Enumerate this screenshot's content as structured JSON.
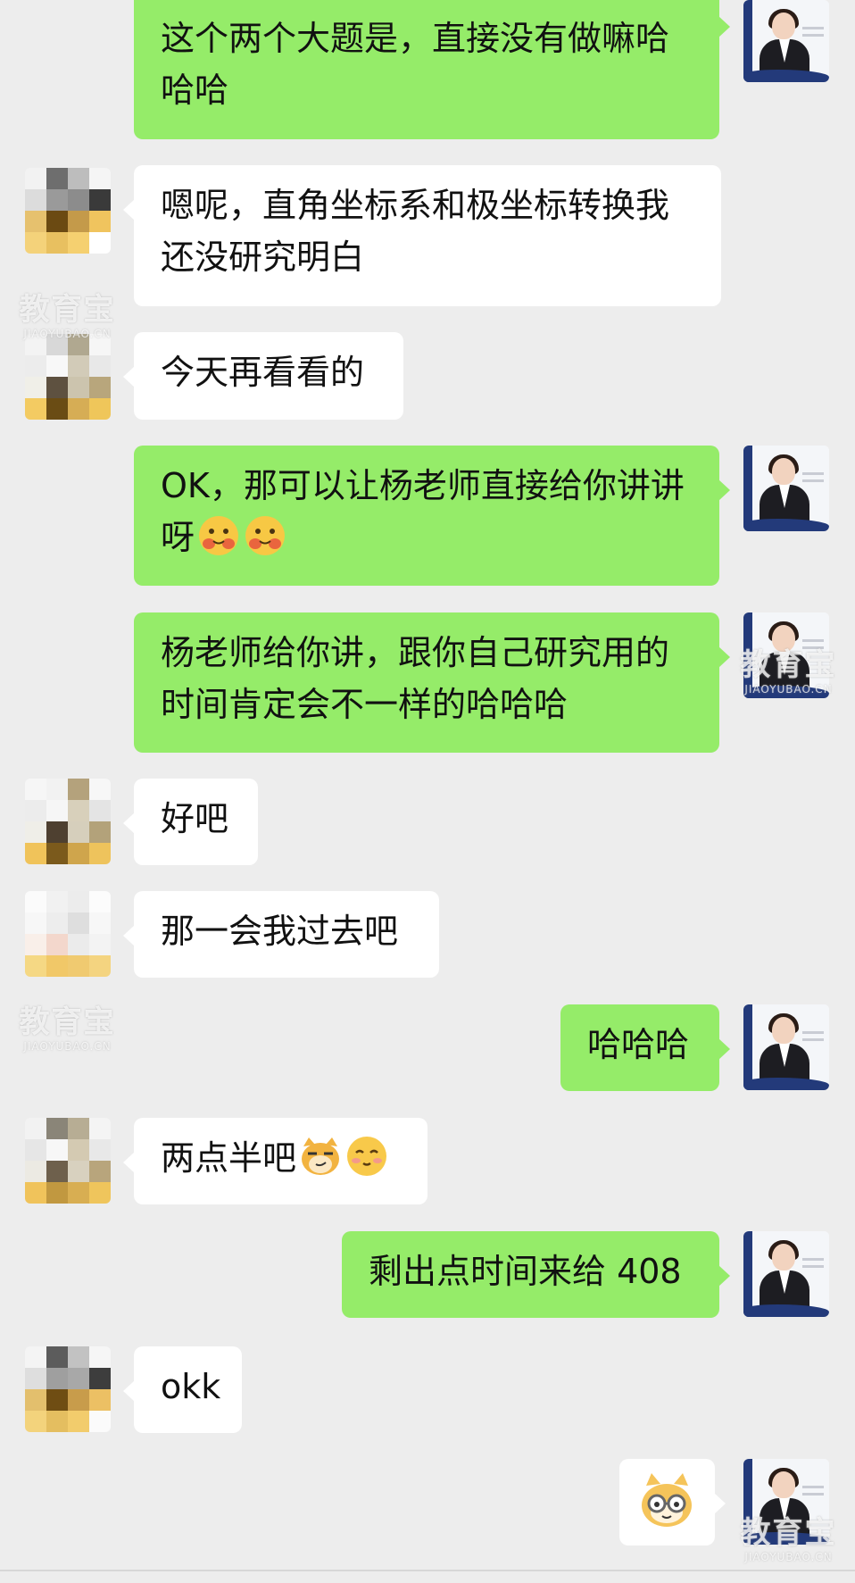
{
  "chat": {
    "messages": [
      {
        "side": "right",
        "text": "这个两个大题是，直接没有做嘛哈哈哈"
      },
      {
        "side": "left",
        "text": "嗯呢，直角坐标系和极坐标转换我还没研究明白"
      },
      {
        "side": "left",
        "text": "今天再看看的"
      },
      {
        "side": "right",
        "text": "OK，那可以让杨老师直接给你讲讲呀"
      },
      {
        "side": "right",
        "text": "杨老师给你讲，跟你自己研究用的时间肯定会不一样的哈哈哈"
      },
      {
        "side": "left",
        "text": "好吧"
      },
      {
        "side": "left",
        "text": "那一会我过去吧"
      },
      {
        "side": "right",
        "text": "哈哈哈"
      },
      {
        "side": "left",
        "text": "两点半吧"
      },
      {
        "side": "right",
        "text": "剩出点时间来给 408"
      },
      {
        "side": "left",
        "text": "okk"
      },
      {
        "side": "right",
        "sticker": "cat-glasses-sticker"
      }
    ],
    "emojis": [
      "smirk-cat-emoji",
      "blush-face-emoji"
    ]
  },
  "watermark": {
    "main": "教育宝",
    "sub": "JIAOYUBAO.CN"
  },
  "colors": {
    "background": "#ededed",
    "sent_bubble": "#95ec69",
    "received_bubble": "#ffffff"
  }
}
